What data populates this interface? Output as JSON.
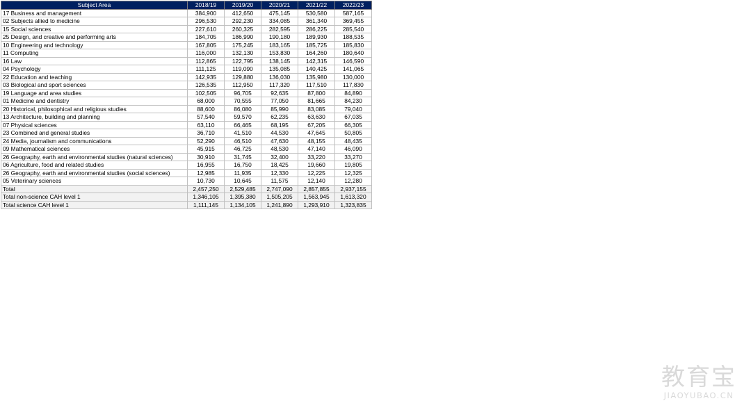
{
  "table": {
    "columns": [
      "Subject Area",
      "2018/19",
      "2019/20",
      "2020/21",
      "2021/22",
      "2022/23"
    ],
    "rows": [
      [
        "17 Business and management",
        "384,900",
        "412,650",
        "475,145",
        "530,580",
        "587,165"
      ],
      [
        "02 Subjects allied to medicine",
        "296,530",
        "292,230",
        "334,085",
        "361,340",
        "369,455"
      ],
      [
        "15 Social sciences",
        "227,610",
        "260,325",
        "282,595",
        "286,225",
        "285,540"
      ],
      [
        "25 Design, and creative and performing arts",
        "184,705",
        "186,990",
        "190,180",
        "189,930",
        "188,535"
      ],
      [
        "10 Engineering and technology",
        "167,805",
        "175,245",
        "183,165",
        "185,725",
        "185,830"
      ],
      [
        "11 Computing",
        "116,000",
        "132,130",
        "153,830",
        "164,260",
        "180,640"
      ],
      [
        "16 Law",
        "112,865",
        "122,795",
        "138,145",
        "142,315",
        "146,590"
      ],
      [
        "04 Psychology",
        "111,125",
        "119,090",
        "135,085",
        "140,425",
        "141,065"
      ],
      [
        "22 Education and teaching",
        "142,935",
        "129,880",
        "136,030",
        "135,980",
        "130,000"
      ],
      [
        "03 Biological and sport sciences",
        "126,535",
        "112,950",
        "117,320",
        "117,510",
        "117,830"
      ],
      [
        "19 Language and area studies",
        "102,505",
        "96,705",
        "92,635",
        "87,800",
        "84,890"
      ],
      [
        "01 Medicine and dentistry",
        "68,000",
        "70,555",
        "77,050",
        "81,665",
        "84,230"
      ],
      [
        "20 Historical, philosophical and religious studies",
        "88,600",
        "86,080",
        "85,990",
        "83,085",
        "79,040"
      ],
      [
        "13 Architecture, building and planning",
        "57,540",
        "59,570",
        "62,235",
        "63,630",
        "67,035"
      ],
      [
        "07 Physical sciences",
        "63,110",
        "66,465",
        "68,195",
        "67,205",
        "66,305"
      ],
      [
        "23 Combined and general studies",
        "36,710",
        "41,510",
        "44,530",
        "47,645",
        "50,805"
      ],
      [
        "24 Media, journalism and communications",
        "52,290",
        "46,510",
        "47,630",
        "48,155",
        "48,435"
      ],
      [
        "09 Mathematical sciences",
        "45,915",
        "46,725",
        "48,530",
        "47,140",
        "46,090"
      ],
      [
        "26 Geography, earth and environmental studies (natural sciences)",
        "30,910",
        "31,745",
        "32,400",
        "33,220",
        "33,270"
      ],
      [
        "06 Agriculture, food and related studies",
        "16,955",
        "16,750",
        "18,425",
        "19,660",
        "19,805"
      ],
      [
        "26 Geography, earth and environmental studies (social sciences)",
        "12,985",
        "11,935",
        "12,330",
        "12,225",
        "12,325"
      ],
      [
        "05 Veterinary sciences",
        "10,730",
        "10,645",
        "11,575",
        "12,140",
        "12,280"
      ]
    ],
    "totals": [
      [
        "Total",
        "2,457,250",
        "2,529,485",
        "2,747,090",
        "2,857,855",
        "2,937,155"
      ],
      [
        "Total non-science CAH level 1",
        "1,346,105",
        "1,395,380",
        "1,505,205",
        "1,563,945",
        "1,613,320"
      ],
      [
        "Total science CAH level 1",
        "1,111,145",
        "1,134,105",
        "1,241,890",
        "1,293,910",
        "1,323,835"
      ]
    ]
  },
  "watermark": {
    "text_cn": "教育宝",
    "text_en": "JIAOYUBAO.CN"
  }
}
